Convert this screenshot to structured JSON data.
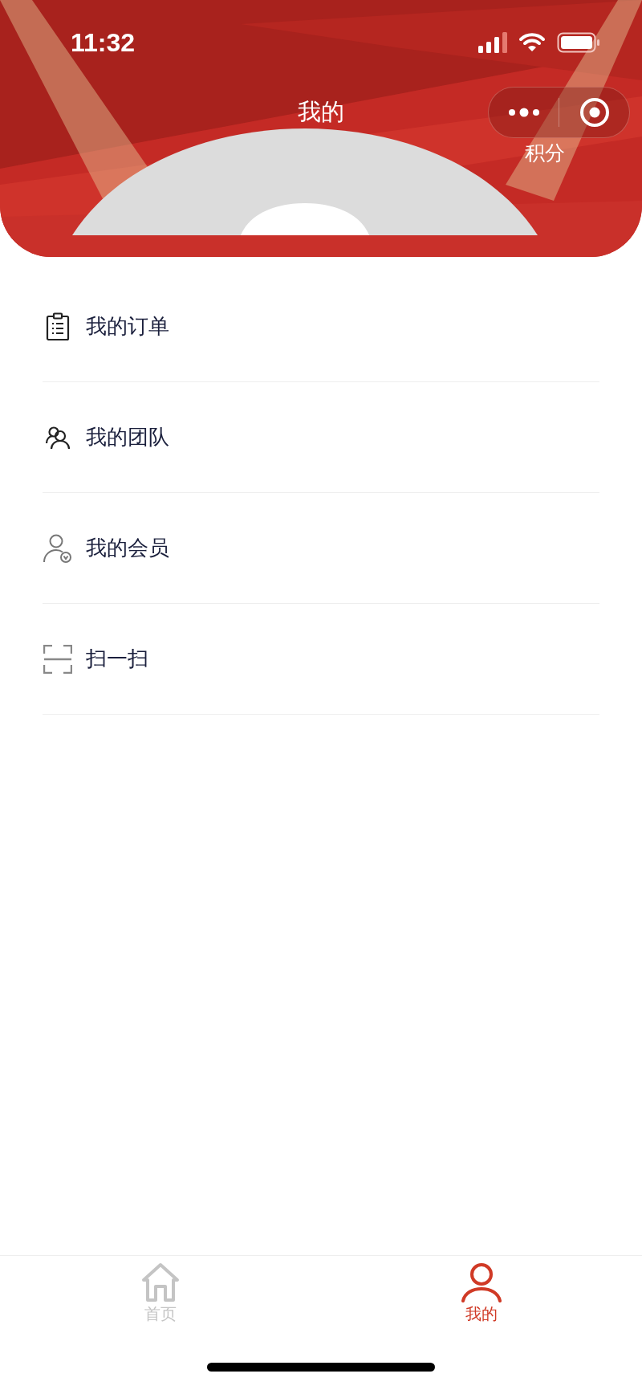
{
  "status_bar": {
    "time": "11:32"
  },
  "header": {
    "title": "我的",
    "points_label": "积分"
  },
  "menu": [
    {
      "label": "我的订单",
      "kind": "orders"
    },
    {
      "label": "我的团队",
      "kind": "team"
    },
    {
      "label": "我的会员",
      "kind": "member"
    },
    {
      "label": "扫一扫",
      "kind": "scan"
    }
  ],
  "tab_bar": [
    {
      "label": "首页",
      "kind": "home",
      "selected": false
    },
    {
      "label": "我的",
      "kind": "mine",
      "selected": true
    }
  ]
}
